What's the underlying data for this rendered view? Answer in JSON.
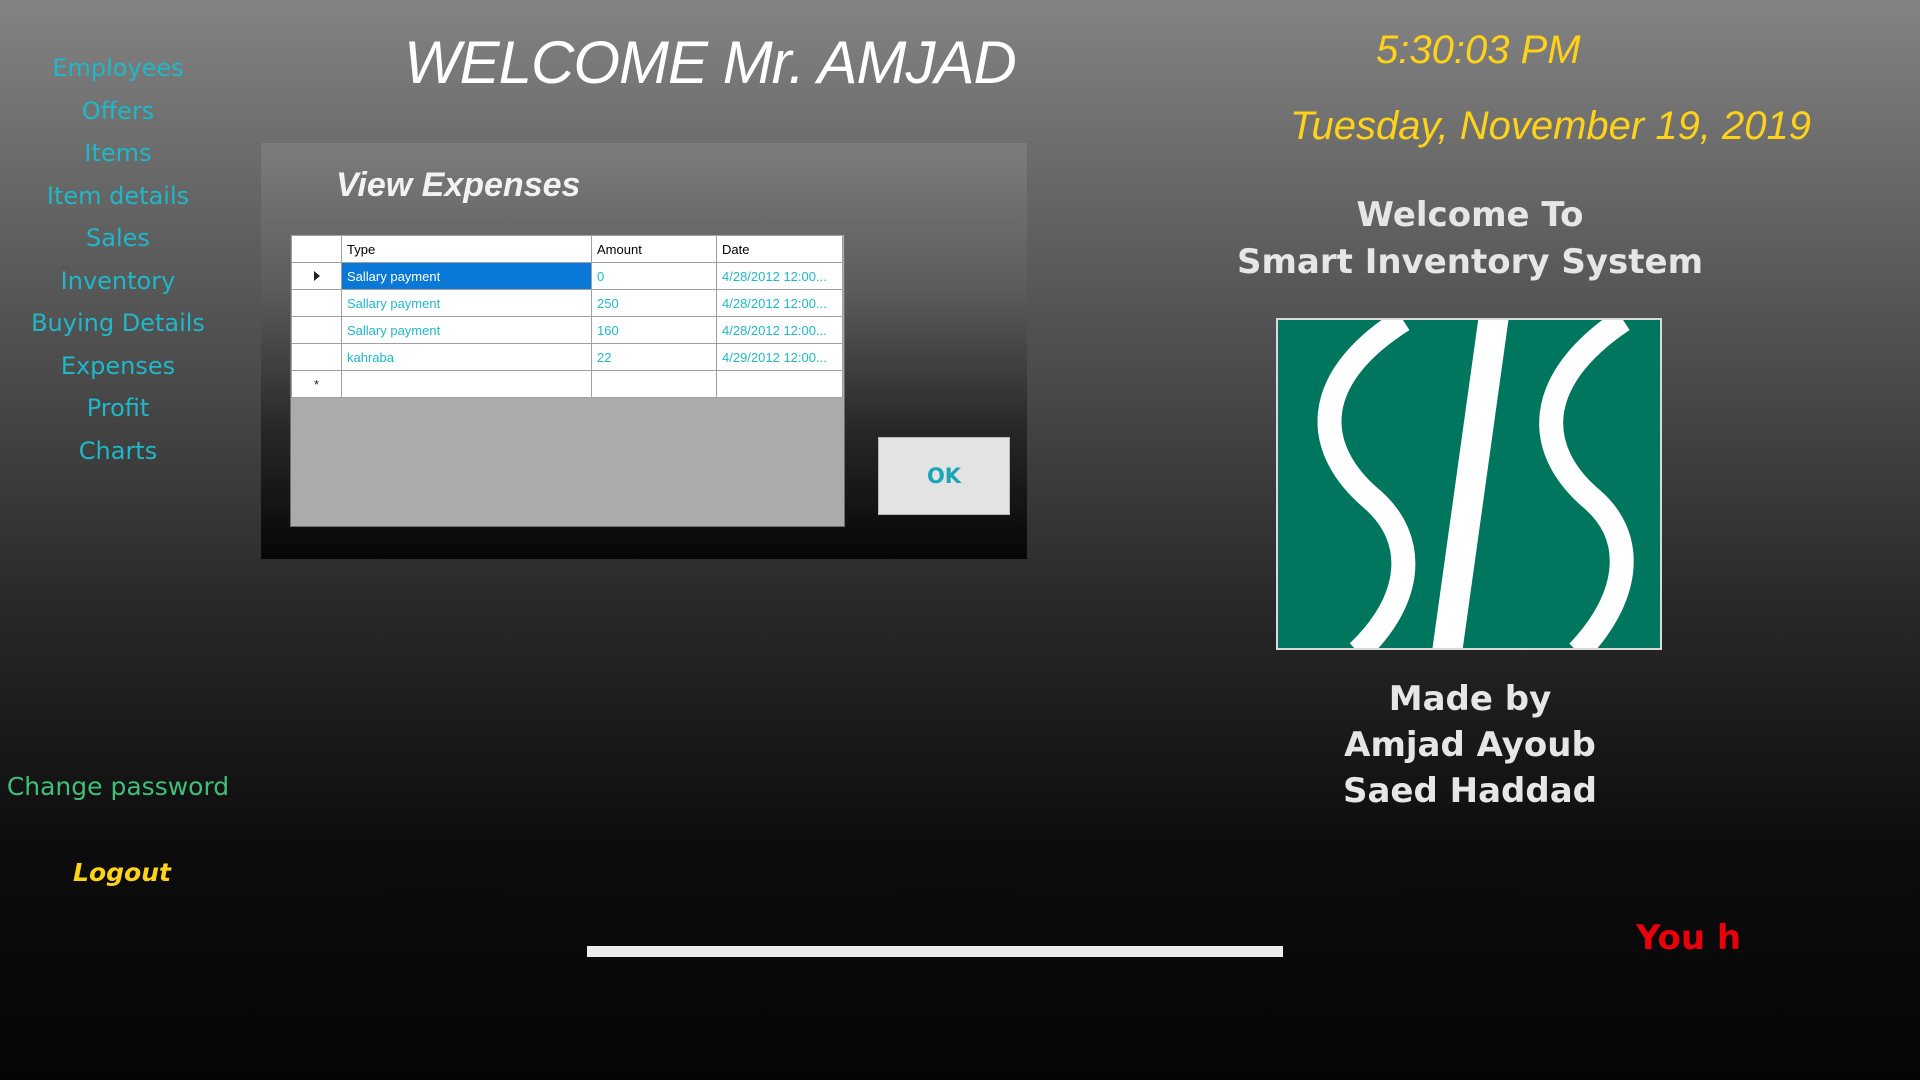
{
  "nav": {
    "items": [
      {
        "label": "Employees"
      },
      {
        "label": "Offers"
      },
      {
        "label": "Items"
      },
      {
        "label": "Item details"
      },
      {
        "label": "Sales"
      },
      {
        "label": "Inventory"
      },
      {
        "label": "Buying Details"
      },
      {
        "label": "Expenses"
      },
      {
        "label": "Profit"
      },
      {
        "label": "Charts"
      }
    ],
    "change_password": "Change password",
    "logout": "Logout"
  },
  "header": {
    "welcome": "WELCOME Mr. AMJAD",
    "time": "5:30:03 PM",
    "date": "Tuesday, November 19, 2019"
  },
  "info": {
    "welcome_line1": "Welcome To",
    "welcome_line2": "Smart Inventory System",
    "made_by": "Made by",
    "author1": "Amjad Ayoub",
    "author2": "Saed Haddad",
    "ticker": "You h"
  },
  "logo": {
    "name": "sis-logo",
    "colors": {
      "background": "#00765e",
      "stroke": "#ffffff"
    }
  },
  "dialog": {
    "title": "View Expenses",
    "ok_label": "OK",
    "columns": [
      "Type",
      "Amount",
      "Date"
    ],
    "rows": [
      {
        "type": "Sallary payment",
        "amount": "0",
        "date": "4/28/2012 12:00..."
      },
      {
        "type": "Sallary payment",
        "amount": "250",
        "date": "4/28/2012 12:00..."
      },
      {
        "type": "Sallary payment",
        "amount": "160",
        "date": "4/28/2012 12:00..."
      },
      {
        "type": "kahraba",
        "amount": "22",
        "date": "4/29/2012 12:00..."
      }
    ],
    "new_row_marker": "*"
  },
  "colors": {
    "accent_cyan": "#1fb8c8",
    "clock_yellow": "#ffd21a",
    "selection_blue": "#0a78d7",
    "ticker_red": "#e8000b",
    "change_password_green": "#3fbf78"
  }
}
